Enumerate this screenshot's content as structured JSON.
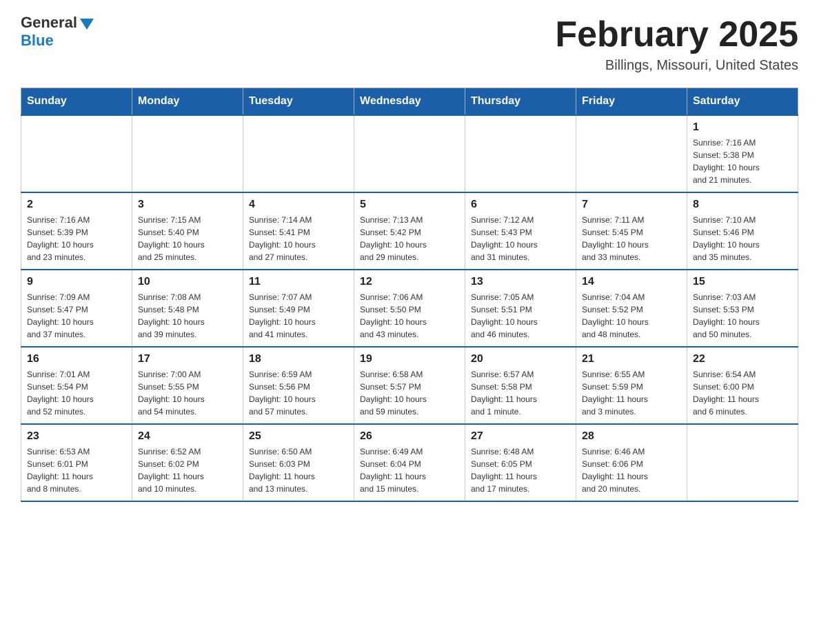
{
  "logo": {
    "general": "General",
    "blue": "Blue"
  },
  "title": "February 2025",
  "location": "Billings, Missouri, United States",
  "days_of_week": [
    "Sunday",
    "Monday",
    "Tuesday",
    "Wednesday",
    "Thursday",
    "Friday",
    "Saturday"
  ],
  "weeks": [
    [
      {
        "day": "",
        "info": ""
      },
      {
        "day": "",
        "info": ""
      },
      {
        "day": "",
        "info": ""
      },
      {
        "day": "",
        "info": ""
      },
      {
        "day": "",
        "info": ""
      },
      {
        "day": "",
        "info": ""
      },
      {
        "day": "1",
        "info": "Sunrise: 7:16 AM\nSunset: 5:38 PM\nDaylight: 10 hours\nand 21 minutes."
      }
    ],
    [
      {
        "day": "2",
        "info": "Sunrise: 7:16 AM\nSunset: 5:39 PM\nDaylight: 10 hours\nand 23 minutes."
      },
      {
        "day": "3",
        "info": "Sunrise: 7:15 AM\nSunset: 5:40 PM\nDaylight: 10 hours\nand 25 minutes."
      },
      {
        "day": "4",
        "info": "Sunrise: 7:14 AM\nSunset: 5:41 PM\nDaylight: 10 hours\nand 27 minutes."
      },
      {
        "day": "5",
        "info": "Sunrise: 7:13 AM\nSunset: 5:42 PM\nDaylight: 10 hours\nand 29 minutes."
      },
      {
        "day": "6",
        "info": "Sunrise: 7:12 AM\nSunset: 5:43 PM\nDaylight: 10 hours\nand 31 minutes."
      },
      {
        "day": "7",
        "info": "Sunrise: 7:11 AM\nSunset: 5:45 PM\nDaylight: 10 hours\nand 33 minutes."
      },
      {
        "day": "8",
        "info": "Sunrise: 7:10 AM\nSunset: 5:46 PM\nDaylight: 10 hours\nand 35 minutes."
      }
    ],
    [
      {
        "day": "9",
        "info": "Sunrise: 7:09 AM\nSunset: 5:47 PM\nDaylight: 10 hours\nand 37 minutes."
      },
      {
        "day": "10",
        "info": "Sunrise: 7:08 AM\nSunset: 5:48 PM\nDaylight: 10 hours\nand 39 minutes."
      },
      {
        "day": "11",
        "info": "Sunrise: 7:07 AM\nSunset: 5:49 PM\nDaylight: 10 hours\nand 41 minutes."
      },
      {
        "day": "12",
        "info": "Sunrise: 7:06 AM\nSunset: 5:50 PM\nDaylight: 10 hours\nand 43 minutes."
      },
      {
        "day": "13",
        "info": "Sunrise: 7:05 AM\nSunset: 5:51 PM\nDaylight: 10 hours\nand 46 minutes."
      },
      {
        "day": "14",
        "info": "Sunrise: 7:04 AM\nSunset: 5:52 PM\nDaylight: 10 hours\nand 48 minutes."
      },
      {
        "day": "15",
        "info": "Sunrise: 7:03 AM\nSunset: 5:53 PM\nDaylight: 10 hours\nand 50 minutes."
      }
    ],
    [
      {
        "day": "16",
        "info": "Sunrise: 7:01 AM\nSunset: 5:54 PM\nDaylight: 10 hours\nand 52 minutes."
      },
      {
        "day": "17",
        "info": "Sunrise: 7:00 AM\nSunset: 5:55 PM\nDaylight: 10 hours\nand 54 minutes."
      },
      {
        "day": "18",
        "info": "Sunrise: 6:59 AM\nSunset: 5:56 PM\nDaylight: 10 hours\nand 57 minutes."
      },
      {
        "day": "19",
        "info": "Sunrise: 6:58 AM\nSunset: 5:57 PM\nDaylight: 10 hours\nand 59 minutes."
      },
      {
        "day": "20",
        "info": "Sunrise: 6:57 AM\nSunset: 5:58 PM\nDaylight: 11 hours\nand 1 minute."
      },
      {
        "day": "21",
        "info": "Sunrise: 6:55 AM\nSunset: 5:59 PM\nDaylight: 11 hours\nand 3 minutes."
      },
      {
        "day": "22",
        "info": "Sunrise: 6:54 AM\nSunset: 6:00 PM\nDaylight: 11 hours\nand 6 minutes."
      }
    ],
    [
      {
        "day": "23",
        "info": "Sunrise: 6:53 AM\nSunset: 6:01 PM\nDaylight: 11 hours\nand 8 minutes."
      },
      {
        "day": "24",
        "info": "Sunrise: 6:52 AM\nSunset: 6:02 PM\nDaylight: 11 hours\nand 10 minutes."
      },
      {
        "day": "25",
        "info": "Sunrise: 6:50 AM\nSunset: 6:03 PM\nDaylight: 11 hours\nand 13 minutes."
      },
      {
        "day": "26",
        "info": "Sunrise: 6:49 AM\nSunset: 6:04 PM\nDaylight: 11 hours\nand 15 minutes."
      },
      {
        "day": "27",
        "info": "Sunrise: 6:48 AM\nSunset: 6:05 PM\nDaylight: 11 hours\nand 17 minutes."
      },
      {
        "day": "28",
        "info": "Sunrise: 6:46 AM\nSunset: 6:06 PM\nDaylight: 11 hours\nand 20 minutes."
      },
      {
        "day": "",
        "info": ""
      }
    ]
  ]
}
